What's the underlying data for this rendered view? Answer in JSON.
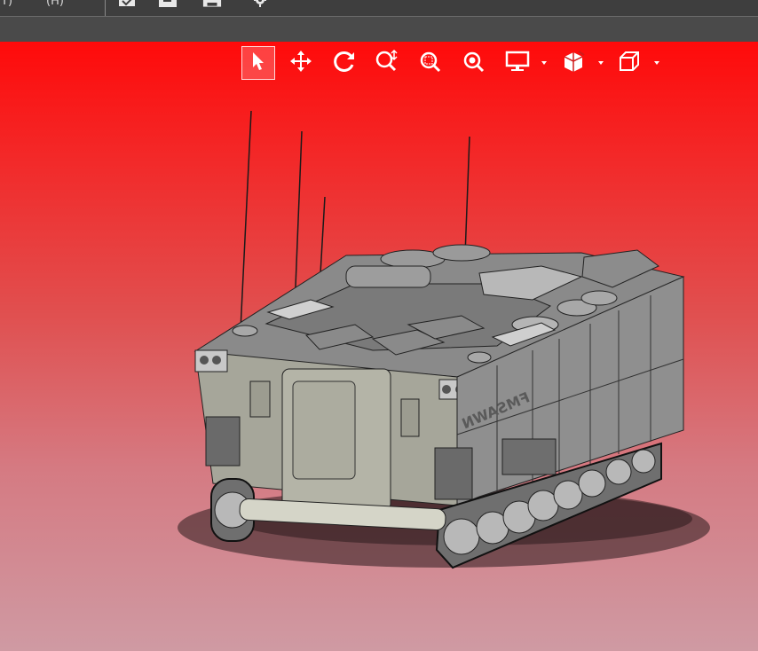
{
  "menubar": {
    "items": [
      {
        "label": "(T)"
      },
      {
        "label": "(H)"
      }
    ],
    "quick_access_icons": [
      "open-icon",
      "save-icon",
      "print-icon",
      "settings-gear-icon"
    ]
  },
  "view_toolbar": {
    "buttons": [
      {
        "icon": "select-arrow-icon",
        "active": true
      },
      {
        "icon": "pan-move-icon",
        "active": false
      },
      {
        "icon": "rotate-icon",
        "active": false
      },
      {
        "icon": "zoom-dynamic-icon",
        "active": false
      },
      {
        "icon": "zoom-window-icon",
        "active": false
      },
      {
        "icon": "zoom-fit-icon",
        "active": false
      },
      {
        "icon": "display-mode-icon",
        "dropdown": true
      },
      {
        "icon": "section-view-icon",
        "dropdown": true
      },
      {
        "icon": "view-orientation-cube-icon",
        "dropdown": true
      }
    ]
  },
  "viewport": {
    "background_top": "#ff0a0a",
    "background_bottom": "#cf9aa3",
    "model_text": "FMSAWN"
  }
}
